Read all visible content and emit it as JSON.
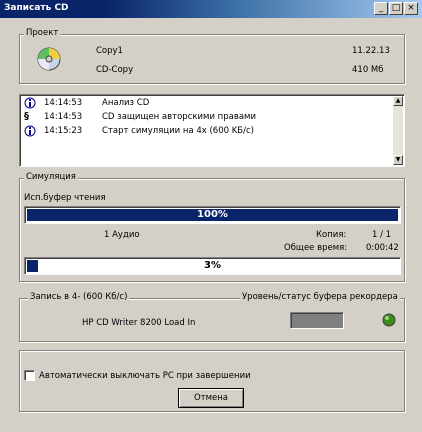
{
  "window": {
    "title": "Записать CD"
  },
  "titlebar_buttons": [
    "_",
    "□",
    "×"
  ],
  "project": {
    "legend": "Проект",
    "name": "Copy1",
    "date": "11.22.13",
    "type": "CD-Copy",
    "size": "410 Mб"
  },
  "log": [
    {
      "time": "14:14:53",
      "text": "Анализ CD",
      "icon": "info-icon"
    },
    {
      "time": "14:14:53",
      "text": "CD защищен авторскими правами",
      "icon": "copyright-icon"
    },
    {
      "time": "14:15:23",
      "text": "Старт симуляции на 4x (600 KБ/с)",
      "icon": "info-icon"
    }
  ],
  "simulation": {
    "legend": "Симуляция",
    "buffer_label": "Исп.буфер чтения",
    "buffer_value": 100,
    "buffer_text": "100%",
    "track_text": "1 Аудио",
    "copy_label": "Копия:",
    "copy_value": "1 / 1",
    "total_time_label": "Общее время:",
    "total_time_value": "0:00:42",
    "progress_value": 3,
    "progress_text": "3%"
  },
  "recorder": {
    "legend_left": "Запись в 4- (600 Кб/с)",
    "legend_right": "Уровень/статус буфера рекордера",
    "device": "HP CD Writer 8200 Load In",
    "status_color": "#3c8c1c"
  },
  "bottom": {
    "checkbox_label": "Автоматически выключать PC при завершении",
    "cancel_label": "Отмена"
  }
}
